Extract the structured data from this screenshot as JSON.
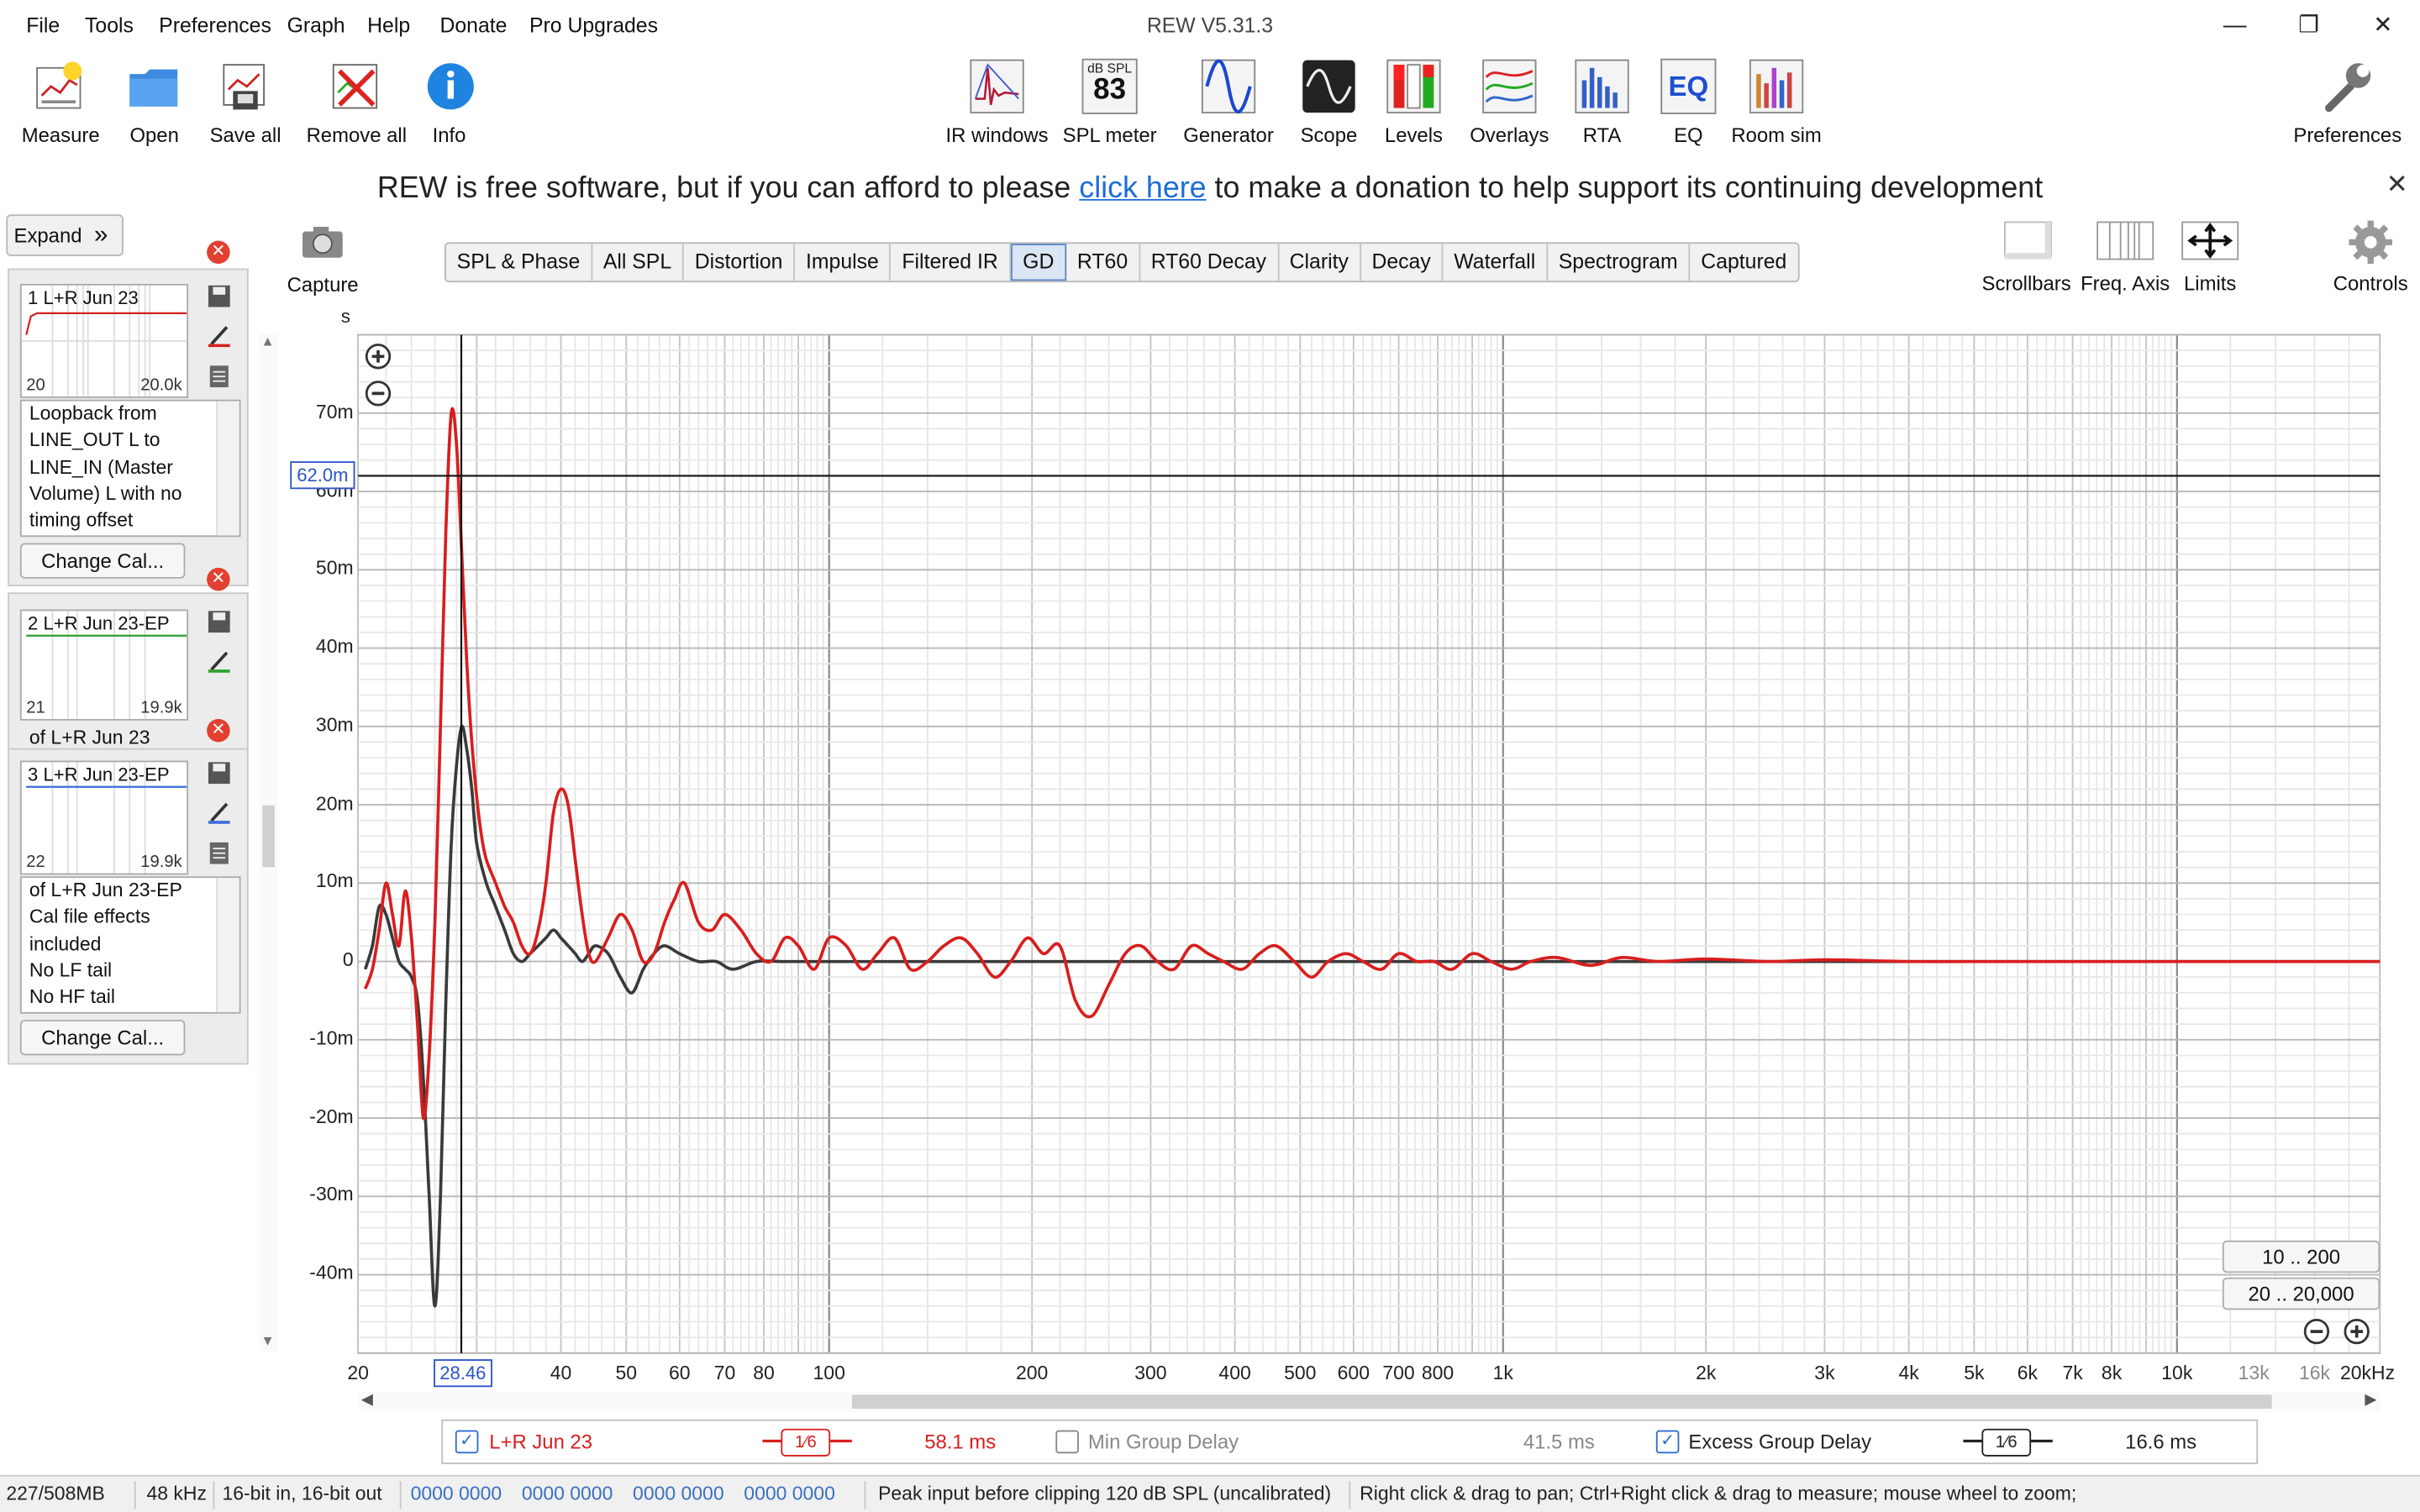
{
  "window": {
    "title": "REW V5.31.3",
    "minimize": "—",
    "maximize": "❐",
    "close": "✕"
  },
  "menu": [
    "File",
    "Tools",
    "Preferences",
    "Graph",
    "Help",
    "Donate",
    "Pro Upgrades"
  ],
  "toolbar_left": [
    {
      "label": "Measure",
      "icon": "measure-icon"
    },
    {
      "label": "Open",
      "icon": "folder-icon"
    },
    {
      "label": "Save all",
      "icon": "save-all-icon"
    },
    {
      "label": "Remove all",
      "icon": "remove-all-icon"
    },
    {
      "label": "Info",
      "icon": "info-icon"
    }
  ],
  "toolbar_center": [
    {
      "label": "IR windows",
      "icon": "ir-windows-icon"
    },
    {
      "label": "SPL meter",
      "icon": "spl-meter-icon",
      "icon_text_top": "dB SPL",
      "icon_text_value": "83"
    },
    {
      "label": "Generator",
      "icon": "generator-icon"
    },
    {
      "label": "Scope",
      "icon": "scope-icon"
    },
    {
      "label": "Levels",
      "icon": "levels-icon"
    },
    {
      "label": "Overlays",
      "icon": "overlays-icon"
    },
    {
      "label": "RTA",
      "icon": "rta-icon"
    },
    {
      "label": "EQ",
      "icon": "eq-icon",
      "icon_text": "EQ"
    },
    {
      "label": "Room sim",
      "icon": "room-sim-icon"
    }
  ],
  "toolbar_right": {
    "label": "Preferences",
    "icon": "wrench-icon"
  },
  "banner": {
    "before": "REW is free software, but if you can afford to please ",
    "link": "click here",
    "after": " to make a donation to help support its continuing development",
    "close": "✕"
  },
  "left_panel": {
    "expand_label": "Expand",
    "expand_icon": "»",
    "measurements": [
      {
        "title": "1 L+R Jun 23",
        "freq_lo": "20",
        "freq_hi": "20.0k",
        "line_color": "#d42020",
        "notes": [
          "Loopback from",
          "LINE_OUT L to",
          "LINE_IN (Master",
          "Volume) L with no",
          "timing offset"
        ],
        "cal_button": "Change Cal..."
      },
      {
        "title": "2 L+R Jun 23-EP",
        "freq_lo": "21",
        "freq_hi": "19.9k",
        "line_color": "#2ea02e",
        "notes": [
          "of L+R Jun 23"
        ]
      },
      {
        "title": "3 L+R Jun 23-EP",
        "freq_lo": "22",
        "freq_hi": "19.9k",
        "line_color": "#3a6fd8",
        "notes": [
          "of L+R Jun 23-EP",
          "Cal file effects",
          "included",
          "No LF tail",
          "No HF tail"
        ],
        "cal_button": "Change Cal..."
      }
    ]
  },
  "capture": {
    "label": "Capture",
    "icon": "camera-icon"
  },
  "tabs": [
    "SPL & Phase",
    "All SPL",
    "Distortion",
    "Impulse",
    "Filtered IR",
    "GD",
    "RT60",
    "RT60 Decay",
    "Clarity",
    "Decay",
    "Waterfall",
    "Spectrogram",
    "Captured"
  ],
  "active_tab": "GD",
  "graph_controls": [
    {
      "label": "Scrollbars",
      "icon": "scrollbars-icon"
    },
    {
      "label": "Freq. Axis",
      "icon": "freq-axis-icon"
    },
    {
      "label": "Limits",
      "icon": "limits-icon"
    },
    {
      "label": "Controls",
      "icon": "gear-icon"
    }
  ],
  "chart_data": {
    "type": "line",
    "title": "",
    "xlabel": "",
    "ylabel": "s",
    "x_scale": "log",
    "xlim": [
      20,
      20000
    ],
    "ylim": [
      -50,
      80
    ],
    "grid": true,
    "y_ticks": [
      "70m",
      "60m",
      "50m",
      "40m",
      "30m",
      "20m",
      "10m",
      "0",
      "-10m",
      "-20m",
      "-30m",
      "-40m"
    ],
    "x_ticks": [
      "20",
      "40",
      "50",
      "60",
      "70",
      "80",
      "100",
      "200",
      "300",
      "400",
      "500",
      "600",
      "700",
      "800",
      "1k",
      "2k",
      "3k",
      "4k",
      "5k",
      "6k",
      "7k",
      "8k",
      "10k",
      "13k",
      "16k",
      "20kHz"
    ],
    "cursor": {
      "x": "28.46",
      "y": "62.0m"
    },
    "series": [
      {
        "name": "L+R Jun 23",
        "color": "#d81e1e",
        "x": [
          20.5,
          21,
          21.5,
          22,
          22.5,
          23,
          23.5,
          24,
          24.5,
          25,
          25.5,
          26,
          26.5,
          27,
          27.5,
          28,
          28.5,
          29,
          29.5,
          30,
          30.5,
          31,
          32,
          33,
          34,
          35,
          36,
          37,
          38,
          39,
          40,
          41,
          42,
          43,
          44,
          45,
          47,
          49,
          51,
          53,
          55,
          57,
          59,
          61,
          64,
          67,
          70,
          74,
          78,
          82,
          86,
          90,
          95,
          100,
          106,
          112,
          118,
          125,
          132,
          140,
          148,
          157,
          166,
          176,
          186,
          197,
          208,
          220,
          232,
          245,
          260,
          275,
          290,
          307,
          325,
          345,
          365,
          385,
          410,
          435,
          460,
          490,
          520,
          550,
          585,
          620,
          660,
          700,
          745,
          790,
          840,
          900,
          960,
          1030,
          1100,
          1200,
          1350,
          1500,
          1700,
          2000,
          2500,
          3000,
          4000,
          5000,
          7000,
          10000,
          14000,
          20000
        ],
        "y": [
          -3.5,
          -1,
          4,
          10,
          6,
          2,
          9,
          3,
          -8,
          -20,
          -12,
          5,
          30,
          55,
          70,
          66,
          52,
          38,
          28,
          21,
          16,
          13,
          10,
          7,
          5,
          2,
          1,
          4,
          10,
          19,
          22,
          20,
          13,
          6,
          1,
          0,
          3,
          6,
          4,
          0,
          1,
          5,
          8,
          10,
          5,
          4,
          6,
          4,
          1,
          0,
          3,
          2,
          -1,
          3,
          2,
          -1,
          1,
          3,
          -1,
          0,
          2,
          3,
          1,
          -2,
          0,
          3,
          1,
          2,
          -5,
          -7,
          -3,
          1,
          2,
          0,
          -1,
          2,
          1,
          0,
          -1,
          1,
          2,
          0,
          -2,
          0,
          1,
          0,
          -1,
          1,
          0,
          0,
          -1,
          1,
          0,
          -1,
          0,
          0.5,
          -0.5,
          0.5,
          0,
          0.3,
          0,
          0.2,
          0,
          0,
          0,
          0,
          0,
          0
        ]
      },
      {
        "name": "Excess Group Delay",
        "color": "#3a3a3a",
        "x": [
          20.5,
          21,
          21.5,
          22,
          22.5,
          23,
          23.5,
          24,
          24.5,
          25,
          25.5,
          26,
          26.5,
          27,
          27.5,
          28,
          28.5,
          29,
          29.5,
          30,
          31,
          32,
          33,
          34,
          35,
          36,
          37,
          38,
          39,
          40,
          41,
          42,
          43,
          44,
          45,
          47,
          49,
          51,
          53,
          55,
          57,
          60,
          64,
          68,
          72,
          78,
          85,
          95,
          110,
          130,
          160,
          200,
          300,
          500,
          1000,
          2000,
          5000,
          20000
        ],
        "y": [
          -1,
          2,
          7,
          6,
          3,
          0,
          -1,
          -2,
          -5,
          -15,
          -30,
          -44,
          -30,
          -5,
          15,
          25,
          30,
          27,
          22,
          15,
          10,
          7,
          4,
          1,
          0,
          1,
          2,
          3,
          4,
          3,
          2,
          1,
          0,
          1,
          2,
          1,
          -2,
          -4,
          -1,
          1,
          2,
          1,
          0,
          0,
          -1,
          0,
          0,
          0,
          0,
          0,
          0,
          0,
          0,
          0,
          0,
          0,
          0,
          0
        ]
      }
    ]
  },
  "range_buttons": [
    "10 .. 200",
    "20 .. 20,000"
  ],
  "legend": {
    "items": [
      {
        "label": "L+R Jun 23",
        "checked": true,
        "color": "#d81e1e",
        "smoothing": "1⁄6",
        "value": "58.1 ms"
      },
      {
        "label": "Min Group Delay",
        "checked": false,
        "color": "#888888",
        "value": "41.5 ms"
      },
      {
        "label": "Excess Group Delay",
        "checked": true,
        "color": "#222222",
        "smoothing": "1⁄6",
        "value": "16.6 ms"
      }
    ]
  },
  "status": {
    "memory": "227/508MB",
    "sample_rate": "48 kHz",
    "bits": "16-bit in, 16-bit out",
    "levels": [
      "0000 0000",
      "0000 0000",
      "0000 0000",
      "0000 0000"
    ],
    "peak": "Peak input before clipping 120 dB SPL (uncalibrated)",
    "hint": "Right click & drag to pan; Ctrl+Right click & drag to measure; mouse wheel to zoom;"
  }
}
